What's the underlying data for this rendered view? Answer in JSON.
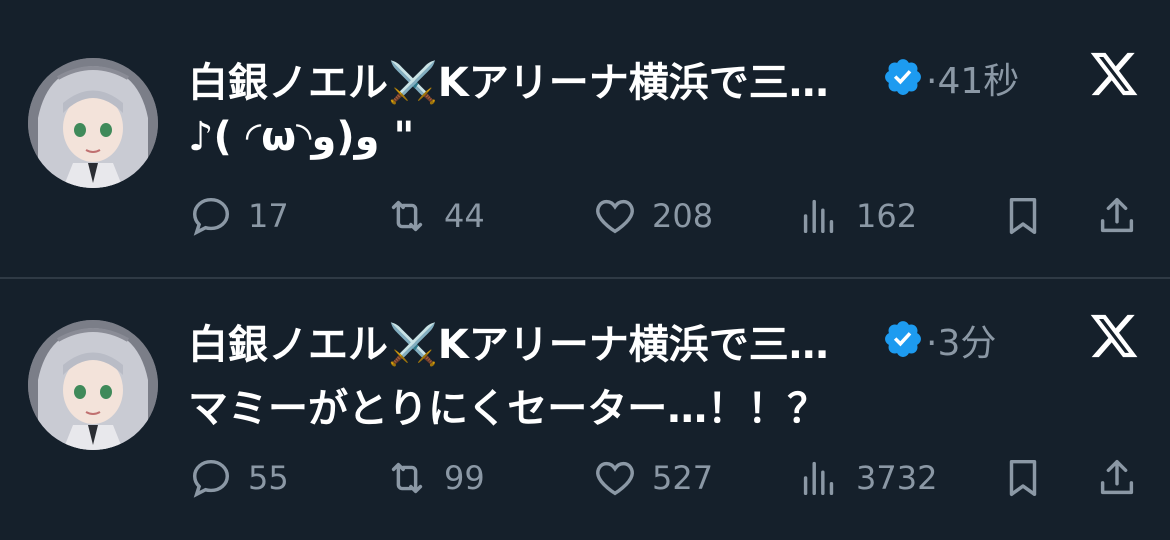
{
  "colors": {
    "background": "#15202b",
    "text_primary": "#ffffff",
    "text_secondary": "#8b98a5",
    "verified": "#1d9bf0",
    "divider": "#2f3a45"
  },
  "tweets": [
    {
      "author": "白銀ノエル⚔️Kアリーナ横浜で三…",
      "separator": "·",
      "time": "41秒",
      "text": "♪( ◜ω◝و)و \"",
      "replies": "17",
      "retweets": "44",
      "likes": "208",
      "views": "162",
      "icons": [
        "reply-icon",
        "retweet-icon",
        "heart-icon",
        "views-icon",
        "bookmark-icon",
        "share-icon",
        "x-logo-icon",
        "verified-badge-icon"
      ]
    },
    {
      "author": "白銀ノエル⚔️Kアリーナ横浜で三…",
      "separator": "·",
      "time": "3分",
      "text": "マミーがとりにくセーター…！！？",
      "replies": "55",
      "retweets": "99",
      "likes": "527",
      "views": "3732",
      "icons": [
        "reply-icon",
        "retweet-icon",
        "heart-icon",
        "views-icon",
        "bookmark-icon",
        "share-icon",
        "x-logo-icon",
        "verified-badge-icon"
      ]
    }
  ]
}
